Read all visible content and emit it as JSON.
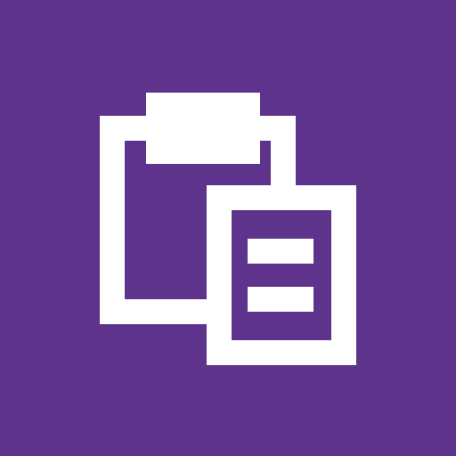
{
  "tile": {
    "icon": "paste-clipboard-icon",
    "background_color": "#5E338B",
    "foreground_color": "#FFFFFF"
  }
}
